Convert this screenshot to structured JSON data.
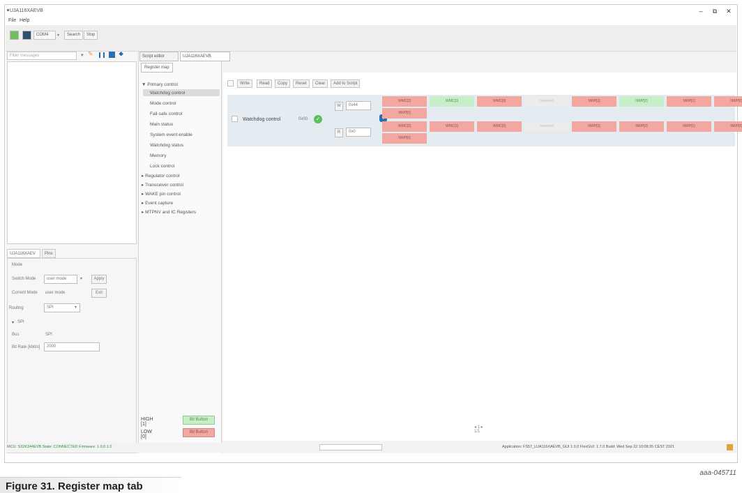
{
  "window": {
    "title": "UJA116XAEVB",
    "minimize": "–",
    "maximize": "⧉",
    "close": "✕"
  },
  "menu": {
    "file": "File",
    "help": "Help"
  },
  "toolbar": {
    "port": "COM4",
    "search": "Search",
    "stop": "Stop"
  },
  "filter": {
    "placeholder": "Filter messages"
  },
  "left_tabs": {
    "tab1": "UJA116XAEV",
    "tab2": "Pins"
  },
  "mode": {
    "legend": "Mode",
    "switch_label": "Switch Mode",
    "switch_value": "user mode",
    "apply": "Apply",
    "current_label": "Current Mode",
    "current_value": "user mode",
    "exit": "Exit"
  },
  "routing": {
    "label": "Routing",
    "value": "SPI"
  },
  "spi": {
    "legend": "SPI",
    "bus_label": "Bus",
    "bus_value": "SPI",
    "bitrate_label": "Bit Rate [kbit/s]",
    "bitrate_value": "2000"
  },
  "editor_tabs": {
    "script": "Script editor",
    "device": "UJA116XAEVB"
  },
  "regmap_tab": "Register map",
  "tree": {
    "primary": "▼ Primary control",
    "children": [
      "Watchdog control",
      "Mode control",
      "Fail-safe control",
      "Main status",
      "System event enable",
      "Watchdog status",
      "Memory",
      "Lock control"
    ],
    "collapsed": [
      "▸ Regulator control",
      "▸ Transceiver control",
      "▸ WAKE pin control",
      "▸ Event capture",
      "▸ MTPNV and IC Registers"
    ]
  },
  "actions": [
    "Write",
    "Read",
    "Copy",
    "Reset",
    "Clear",
    "Add to Script"
  ],
  "register": {
    "name": "Watchdog control",
    "address": "0x00",
    "w_label": "W",
    "w_value": "0x44",
    "r_label": "R",
    "r_value": "0x0",
    "info": "?",
    "row1": [
      {
        "label": "WMC[2]",
        "kind": "red"
      },
      {
        "label": "WMC[1]",
        "kind": "green"
      },
      {
        "label": "WMC[0]",
        "kind": "red"
      },
      {
        "label": "reserved",
        "kind": "gray"
      },
      {
        "label": "NWP[3]",
        "kind": "red"
      },
      {
        "label": "NWP[2]",
        "kind": "green"
      },
      {
        "label": "NWP[1]",
        "kind": "red"
      },
      {
        "label": "NWP[0]",
        "kind": "red"
      }
    ],
    "row2": [
      {
        "label": "WMC[2]",
        "kind": "red"
      },
      {
        "label": "WMC[1]",
        "kind": "red"
      },
      {
        "label": "WMC[0]",
        "kind": "red"
      },
      {
        "label": "reserved",
        "kind": "gray"
      },
      {
        "label": "NWP[3]",
        "kind": "red"
      },
      {
        "label": "NWP[2]",
        "kind": "red"
      },
      {
        "label": "NWP[1]",
        "kind": "red"
      },
      {
        "label": "NWP[0]",
        "kind": "red"
      }
    ]
  },
  "legend_buttons": {
    "high_label": "HIGH [1]",
    "high_btn": "Bit Button",
    "low_label": "LOW [0]",
    "low_btn": "Bit Button"
  },
  "pager": {
    "arrows": "◂ 1 ▸",
    "count": "1/1"
  },
  "status": {
    "left": "MCU: S32K344EVB  State: CONNECTED  Firmware: 1.0.0.1.0",
    "right": "Application: FS57_UJA116XAEVB_GUI 1.0.0  FlexGUI: 1.7.0  Build: Wed Sep 22 10:08:35 CEST 2021"
  },
  "figure_tag": "aaa-045711",
  "caption": "Figure 31.  Register map tab",
  "colors": {
    "bit_high": "#c7efc7",
    "bit_low": "#f3a7a1",
    "row_bg": "#e4ebf1"
  }
}
